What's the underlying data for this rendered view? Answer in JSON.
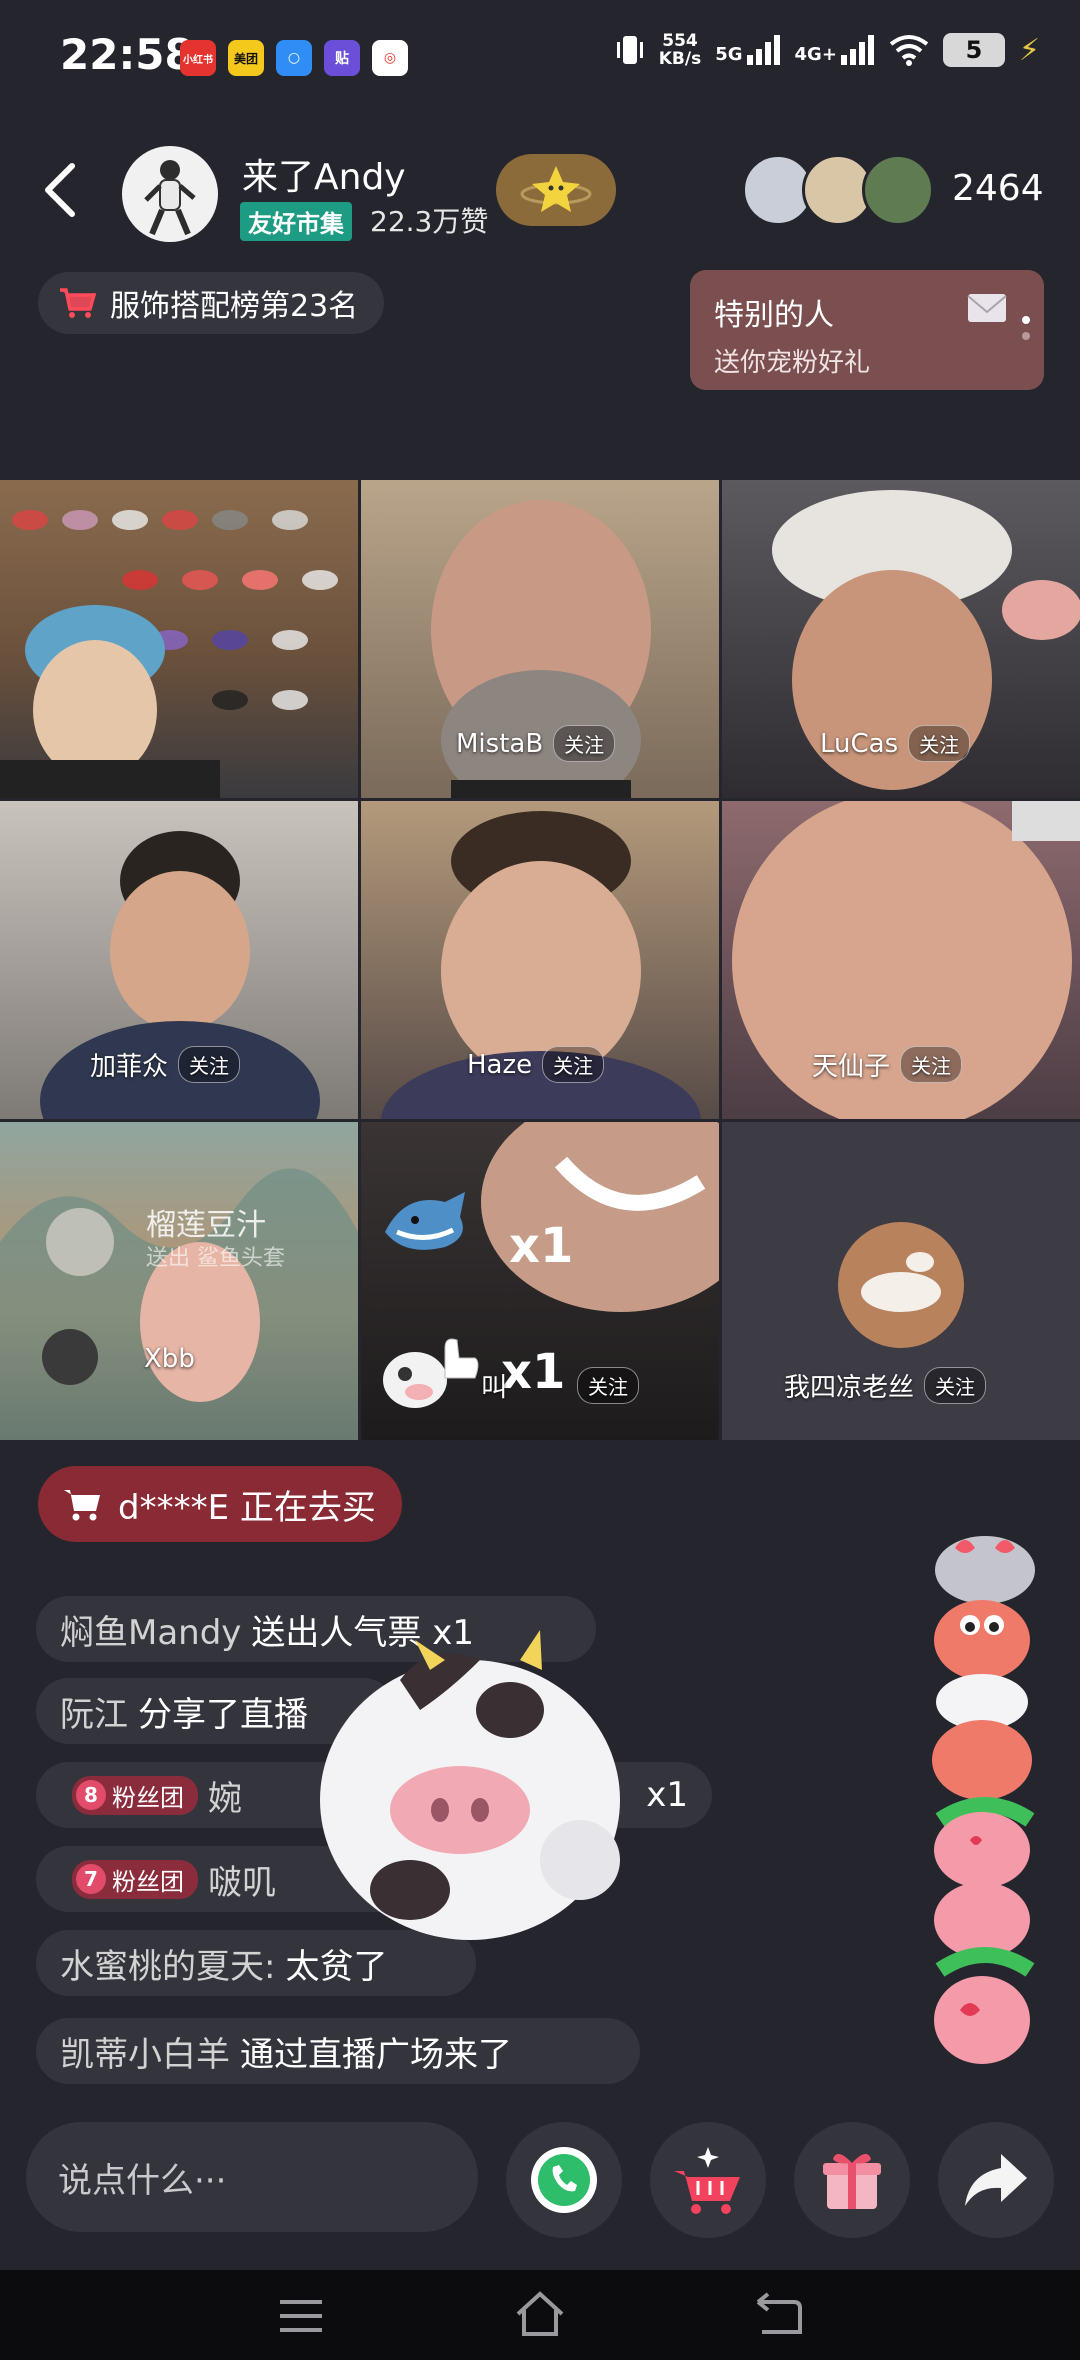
{
  "status_bar": {
    "time": "22:58",
    "app_icons": [
      "小红书",
      "美团",
      "○",
      "贴",
      "◎"
    ],
    "net_speed_value": "554",
    "net_speed_unit": "KB/s",
    "signal_5g": "5G",
    "signal_4g": "4G+",
    "battery": "5"
  },
  "header": {
    "host_name": "来了Andy",
    "host_tag": "友好市集",
    "likes": "22.3万赞",
    "viewer_count": "2464"
  },
  "rank_badge": {
    "label": "服饰搭配榜第23名"
  },
  "special_card": {
    "title": "特别的人",
    "subtitle": "送你宠粉好礼"
  },
  "grid": {
    "follow_label": "关注",
    "tiles": [
      {
        "name": ""
      },
      {
        "name": "MistaB"
      },
      {
        "name": "LuCas"
      },
      {
        "name": "加菲众"
      },
      {
        "name": "Haze"
      },
      {
        "name": "天仙子"
      },
      {
        "name": "Xbb"
      },
      {
        "name": "叫"
      },
      {
        "name": "我四凉老丝"
      }
    ],
    "gift_overlay": {
      "sender": "榴莲豆汁",
      "text": "送出 鲨鱼头套",
      "multiplier": "x1",
      "multiplier2": "x1"
    }
  },
  "chat": {
    "buying_banner": "d****E 正在去买",
    "lines": [
      {
        "user": "焖鱼Mandy",
        "text": "送出人气票 x1"
      },
      {
        "user": "阮江",
        "text": "分享了直播"
      },
      {
        "fan_level": "8",
        "fan_label": "粉丝团",
        "user": "婉",
        "suffix": "x1"
      },
      {
        "fan_level": "7",
        "fan_label": "粉丝团",
        "user": "啵叽"
      },
      {
        "user": "水蜜桃的夏天:",
        "text": "太贫了"
      },
      {
        "user": "凯蒂小白羊",
        "text": "通过直播广场来了"
      }
    ]
  },
  "bottom_bar": {
    "input_placeholder": "说点什么···"
  },
  "colors": {
    "background": "#25262d",
    "accent_red": "#8a2a35",
    "tag_green": "#1e9b83"
  }
}
